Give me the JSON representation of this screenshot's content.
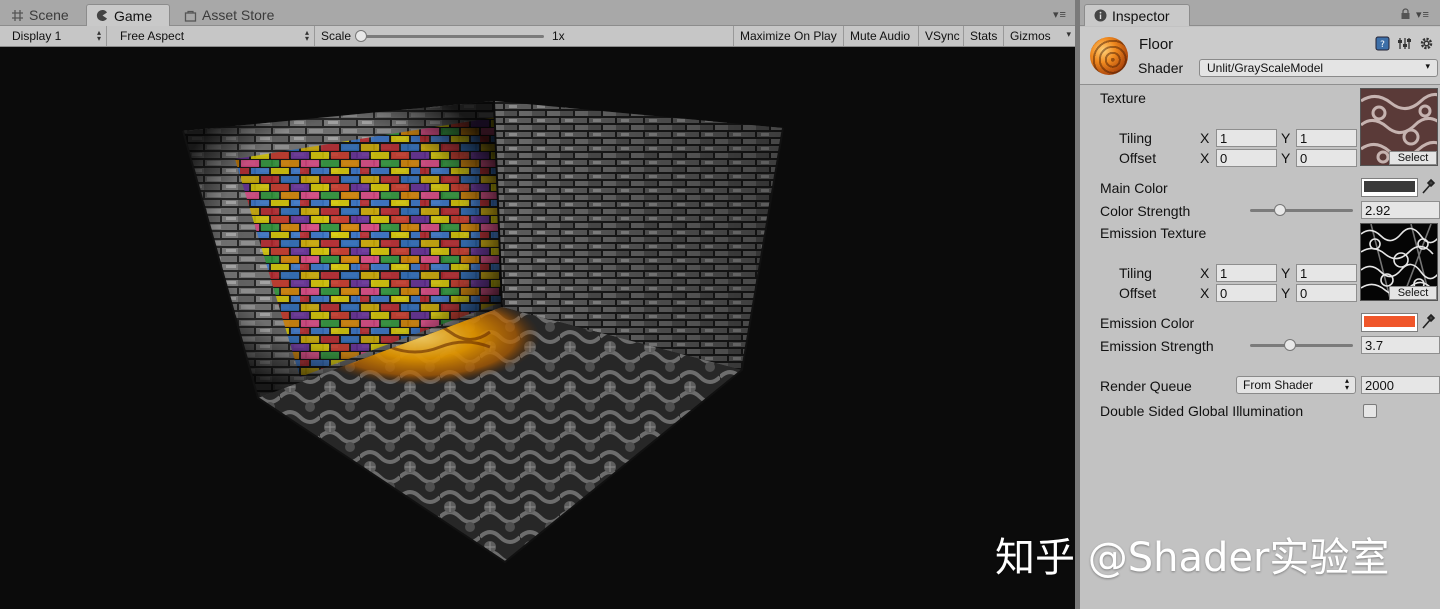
{
  "game_window": {
    "tabs": [
      {
        "label": "Scene",
        "icon": "grid-icon"
      },
      {
        "label": "Game",
        "icon": "pacman-icon"
      },
      {
        "label": "Asset Store",
        "icon": "shopping-bag-icon"
      }
    ],
    "toolbar": {
      "display": "Display 1",
      "aspect": "Free Aspect",
      "scale_label": "Scale",
      "scale_value": "1x",
      "maximize_on_play": "Maximize On Play",
      "mute_audio": "Mute Audio",
      "vsync": "VSync",
      "stats": "Stats",
      "gizmos": "Gizmos"
    }
  },
  "watermark": "知乎 @Shader实验室",
  "inspector": {
    "tab_label": "Inspector",
    "material_name": "Floor",
    "shader_label": "Shader",
    "shader_value": "Unlit/GrayScaleModel",
    "properties": {
      "texture": {
        "label": "Texture",
        "tiling_label": "Tiling",
        "offset_label": "Offset",
        "tiling_x": "1",
        "tiling_y": "1",
        "offset_x": "0",
        "offset_y": "0",
        "select": "Select"
      },
      "main_color": {
        "label": "Main Color",
        "color": "#3a3a3a"
      },
      "color_strength": {
        "label": "Color Strength",
        "value": "2.92",
        "slider_fraction": 0.28
      },
      "emission_texture": {
        "label": "Emission Texture",
        "tiling_label": "Tiling",
        "offset_label": "Offset",
        "tiling_x": "1",
        "tiling_y": "1",
        "offset_x": "0",
        "offset_y": "0",
        "select": "Select"
      },
      "emission_color": {
        "label": "Emission Color",
        "color": "#f0562a"
      },
      "emission_strength": {
        "label": "Emission Strength",
        "value": "3.7",
        "slider_fraction": 0.37
      },
      "render_queue": {
        "label": "Render Queue",
        "mode": "From Shader",
        "value": "2000"
      },
      "double_sided_gi": {
        "label": "Double Sided Global Illumination",
        "checked": false
      }
    },
    "axis_x": "X",
    "axis_y": "Y"
  }
}
